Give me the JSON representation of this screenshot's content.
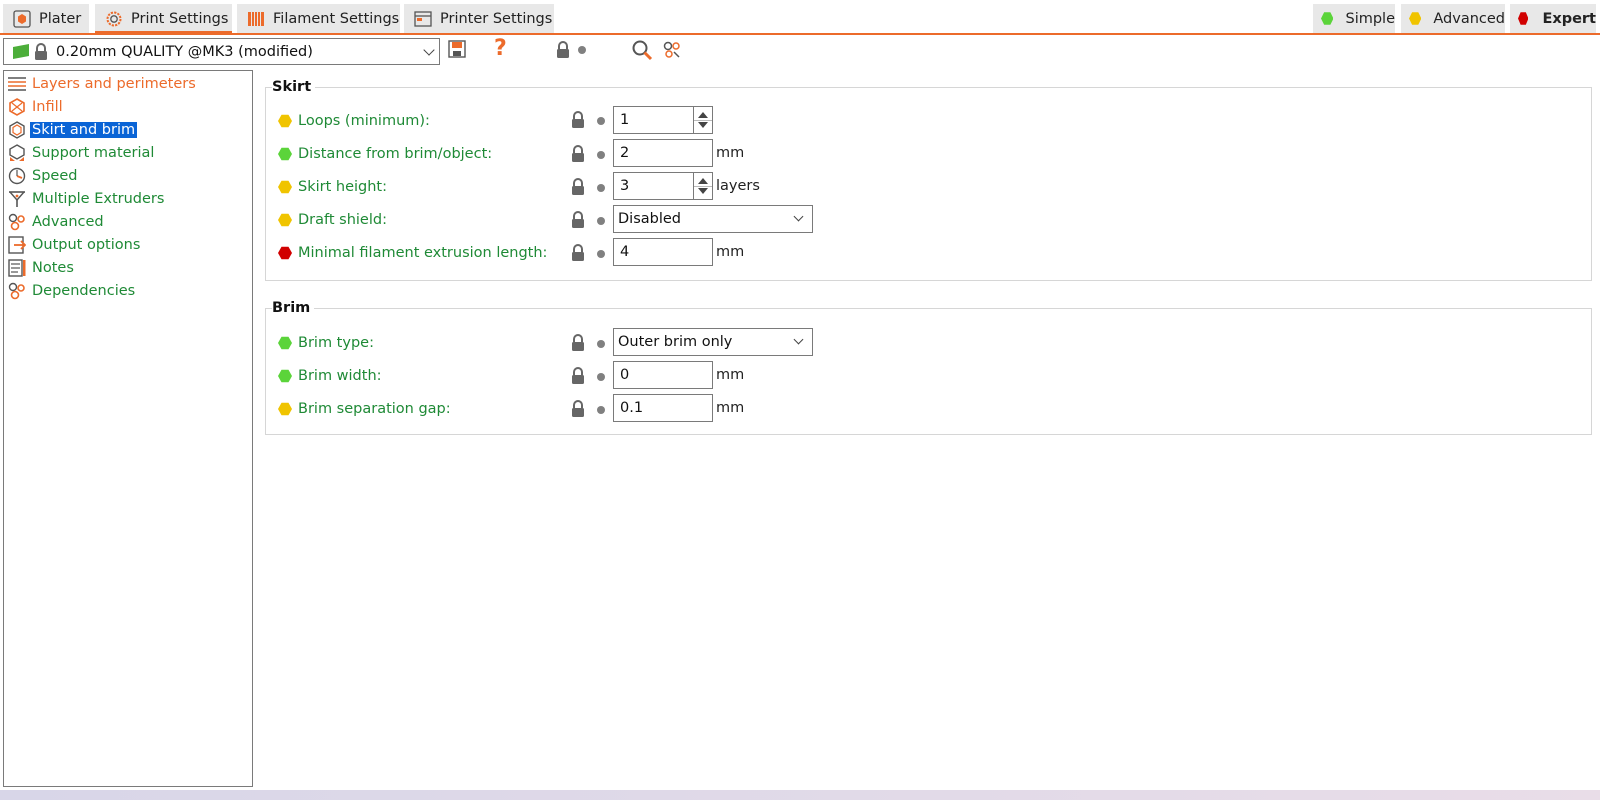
{
  "tabs": [
    {
      "label": "Plater",
      "icon": "plater-icon"
    },
    {
      "label": "Print Settings",
      "icon": "print-settings-icon",
      "active": true
    },
    {
      "label": "Filament Settings",
      "icon": "filament-spool-icon"
    },
    {
      "label": "Printer Settings",
      "icon": "printer-settings-icon"
    }
  ],
  "modes": [
    {
      "label": "Simple",
      "color": "#5bd43a"
    },
    {
      "label": "Advanced",
      "color": "#f0c400"
    },
    {
      "label": "Expert",
      "color": "#d10000",
      "active": true
    }
  ],
  "preset": {
    "name": "0.20mm QUALITY @MK3 (modified)",
    "help_glyph": "?"
  },
  "colors": {
    "accent": "#ec6b2b",
    "green_text": "#1f8a36",
    "simple": "#5bd43a",
    "advanced": "#f0c400",
    "expert": "#d10000",
    "selection": "#0a64d6"
  },
  "pages": [
    {
      "label": "Layers and perimeters",
      "icon": "layers-icon",
      "modified": true
    },
    {
      "label": "Infill",
      "icon": "infill-icon",
      "modified": true
    },
    {
      "label": "Skirt and brim",
      "icon": "skirt-brim-icon",
      "selected": true
    },
    {
      "label": "Support material",
      "icon": "support-material-icon"
    },
    {
      "label": "Speed",
      "icon": "speed-icon"
    },
    {
      "label": "Multiple Extruders",
      "icon": "multiple-extruders-icon"
    },
    {
      "label": "Advanced",
      "icon": "advanced-icon"
    },
    {
      "label": "Output options",
      "icon": "output-options-icon"
    },
    {
      "label": "Notes",
      "icon": "notes-icon"
    },
    {
      "label": "Dependencies",
      "icon": "dependencies-icon"
    }
  ],
  "skirt": {
    "title": "Skirt",
    "options": [
      {
        "label": "Loops (minimum):",
        "mode": "advanced",
        "value": "1",
        "unit": "",
        "widget": "spin"
      },
      {
        "label": "Distance from brim/object:",
        "mode": "simple",
        "value": "2",
        "unit": "mm",
        "widget": "text"
      },
      {
        "label": "Skirt height:",
        "mode": "advanced",
        "value": "3",
        "unit": "layers",
        "widget": "spin"
      },
      {
        "label": "Draft shield:",
        "mode": "advanced",
        "value": "Disabled",
        "unit": "",
        "widget": "select"
      },
      {
        "label": "Minimal filament extrusion length:",
        "mode": "expert",
        "value": "4",
        "unit": "mm",
        "widget": "text"
      }
    ]
  },
  "brim": {
    "title": "Brim",
    "options": [
      {
        "label": "Brim type:",
        "mode": "simple",
        "value": "Outer brim only",
        "unit": "",
        "widget": "select"
      },
      {
        "label": "Brim width:",
        "mode": "simple",
        "value": "0",
        "unit": "mm",
        "widget": "text"
      },
      {
        "label": "Brim separation gap:",
        "mode": "advanced",
        "value": "0.1",
        "unit": "mm",
        "widget": "text"
      }
    ]
  }
}
